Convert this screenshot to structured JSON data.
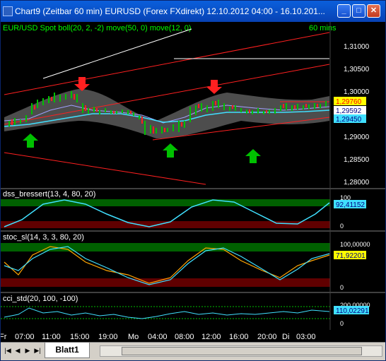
{
  "window": {
    "title": "Chart9 (Zeitbar 60 min)  EURUSD (Forex FXdirekt) 12.10.2012 04:00 - 16.10.201...",
    "minimize": "_",
    "maximize": "□",
    "close": "✕"
  },
  "panes": {
    "price": {
      "label": "EUR/USD Spot  boll(20, 2, -2) move(50, 0) move(12, 0)",
      "interval": "60 mins",
      "ticks": [
        "1,31000",
        "1,30500",
        "1,30000",
        "1,29500",
        "1,29000",
        "1,28500",
        "1,28000"
      ],
      "last_red": "1,29760",
      "last_white": "1,29592",
      "last_cyan": "1,29450"
    },
    "dss": {
      "label": "dss_bressert(13, 4, 80, 20)",
      "value": "92,41152",
      "scale_max": "100",
      "scale_min": "0"
    },
    "stoc": {
      "label": "stoc_sl(14, 3, 3, 80, 20)",
      "value": "71,92201",
      "scale_max": "100,00000",
      "scale_min": "0"
    },
    "cci": {
      "label": "cci_std(20, 100, -100)",
      "value": "110,02291",
      "scale_max": "200,00000",
      "scale_min": "0"
    }
  },
  "time_axis": [
    "Fr",
    "07:00",
    "11:00",
    "15:00",
    "19:00",
    "Mo",
    "04:00",
    "08:00",
    "12:00",
    "16:00",
    "20:00",
    "Di",
    "03:00"
  ],
  "sheet_tab": "Blatt1",
  "sheet_nav": [
    "|◀",
    "◀",
    "▶",
    "▶|"
  ],
  "colors": {
    "up_candle": "#00c000",
    "down_candle": "#ff2020",
    "band": "#5a5a5a",
    "ma_fast": "#40e0ff",
    "ma_slow": "#a0a0ff",
    "trend_red": "#ff2020",
    "overbought_zone": "#006000",
    "oversold_zone": "#600000"
  }
}
